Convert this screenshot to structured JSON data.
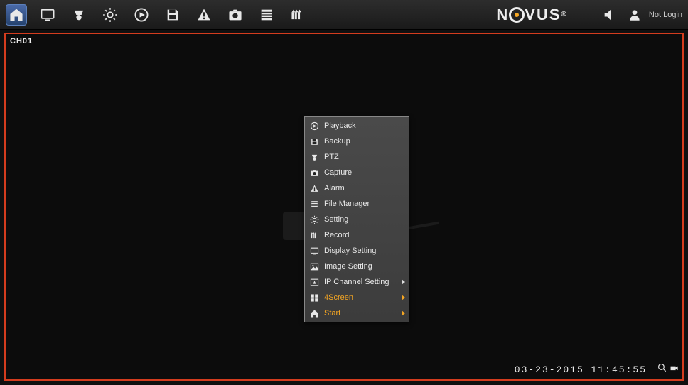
{
  "brand": "NOVUS",
  "login_status": "Not Login",
  "channel_label": "CH01",
  "timestamp": "03-23-2015  11:45:55",
  "toolbar": [
    {
      "name": "home"
    },
    {
      "name": "display"
    },
    {
      "name": "ptz"
    },
    {
      "name": "settings"
    },
    {
      "name": "playback"
    },
    {
      "name": "save"
    },
    {
      "name": "alarm"
    },
    {
      "name": "capture"
    },
    {
      "name": "file-manager"
    },
    {
      "name": "record"
    }
  ],
  "context_menu": {
    "items": [
      {
        "label": "Playback",
        "icon": "playback",
        "submenu": false,
        "accent": false
      },
      {
        "label": "Backup",
        "icon": "save",
        "submenu": false,
        "accent": false
      },
      {
        "label": "PTZ",
        "icon": "ptz",
        "submenu": false,
        "accent": false
      },
      {
        "label": "Capture",
        "icon": "capture",
        "submenu": false,
        "accent": false
      },
      {
        "label": "Alarm",
        "icon": "alarm",
        "submenu": false,
        "accent": false
      },
      {
        "label": "File Manager",
        "icon": "file-manager",
        "submenu": false,
        "accent": false
      },
      {
        "label": "Setting",
        "icon": "settings",
        "submenu": false,
        "accent": false
      },
      {
        "label": "Record",
        "icon": "record",
        "submenu": false,
        "accent": false
      },
      {
        "label": "Display Setting",
        "icon": "display",
        "submenu": false,
        "accent": false
      },
      {
        "label": "Image Setting",
        "icon": "image",
        "submenu": false,
        "accent": false
      },
      {
        "label": "IP Channel Setting",
        "icon": "ip",
        "submenu": true,
        "accent": false
      },
      {
        "label": "4Screen",
        "icon": "grid",
        "submenu": true,
        "accent": true
      },
      {
        "label": "Start",
        "icon": "home",
        "submenu": true,
        "accent": true
      }
    ]
  }
}
